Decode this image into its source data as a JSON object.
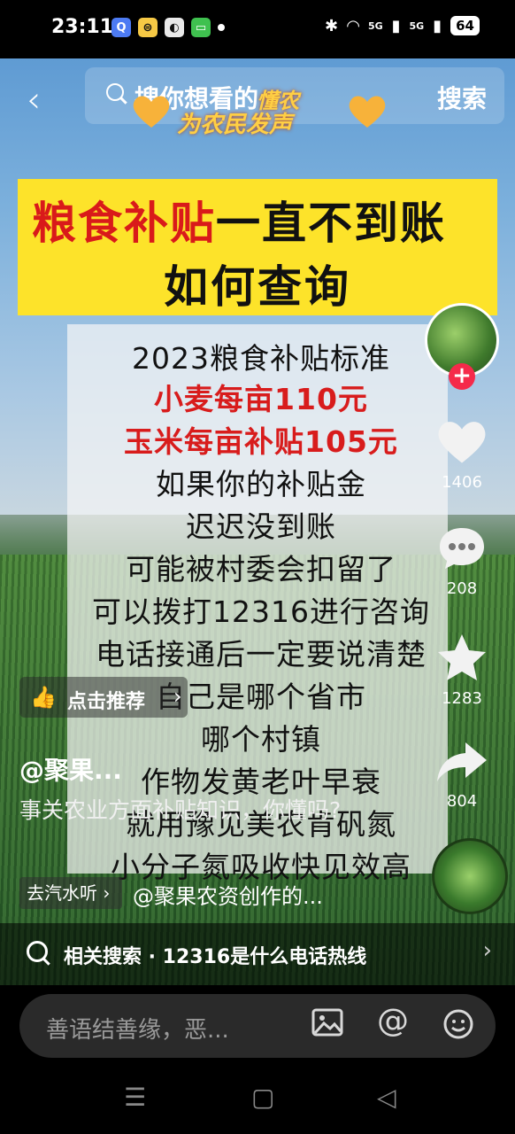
{
  "status_bar": {
    "time": "23:11",
    "net1": "5G",
    "net2": "5G",
    "battery": "64"
  },
  "search": {
    "placeholder": "搜你想看的",
    "button": "搜索",
    "badge_line1": "懂农",
    "badge_line2": "为农民发声"
  },
  "video": {
    "title_red": "粮食补贴",
    "title_black": "一直不到账",
    "title_line2": "如何查询",
    "lines": [
      {
        "text": "2023粮食补贴标准",
        "color": "black"
      },
      {
        "text": "小麦每亩110元",
        "color": "red"
      },
      {
        "text": "玉米每亩补贴105元",
        "color": "red"
      },
      {
        "text": "如果你的补贴金",
        "color": "black"
      },
      {
        "text": "迟迟没到账",
        "color": "black"
      },
      {
        "text": "可能被村委会扣留了",
        "color": "black"
      },
      {
        "text": "可以拨打12316进行咨询",
        "color": "black"
      },
      {
        "text": "电话接通后一定要说清楚",
        "color": "black"
      },
      {
        "text": "自己是哪个省市",
        "color": "black"
      },
      {
        "text": "哪个村镇",
        "color": "black"
      },
      {
        "text": "作物发黄老叶早衰",
        "color": "black"
      },
      {
        "text": "就用豫见美农肯矾氮",
        "color": "black"
      },
      {
        "text": "小分子氮吸收快见效高",
        "color": "black"
      }
    ]
  },
  "side_actions": {
    "likes": "1406",
    "comments": "208",
    "favorites": "1283",
    "shares": "804",
    "follow": "+"
  },
  "recommend": {
    "label": "点击推荐"
  },
  "author": {
    "name": "@聚果..."
  },
  "description": "事关农业方面补贴知识，你懂吗?",
  "music": {
    "chip": "去汽水听 ›",
    "text": "@聚果农资创作的..."
  },
  "related": {
    "label": "相关搜索 · 12316是什么电话热线"
  },
  "comment_bar": {
    "placeholder": "善语结善缘，恶..."
  },
  "colors": {
    "title_bg": "#fde32a",
    "title_red": "#d91a1a",
    "accent_red": "#f52a4a"
  }
}
